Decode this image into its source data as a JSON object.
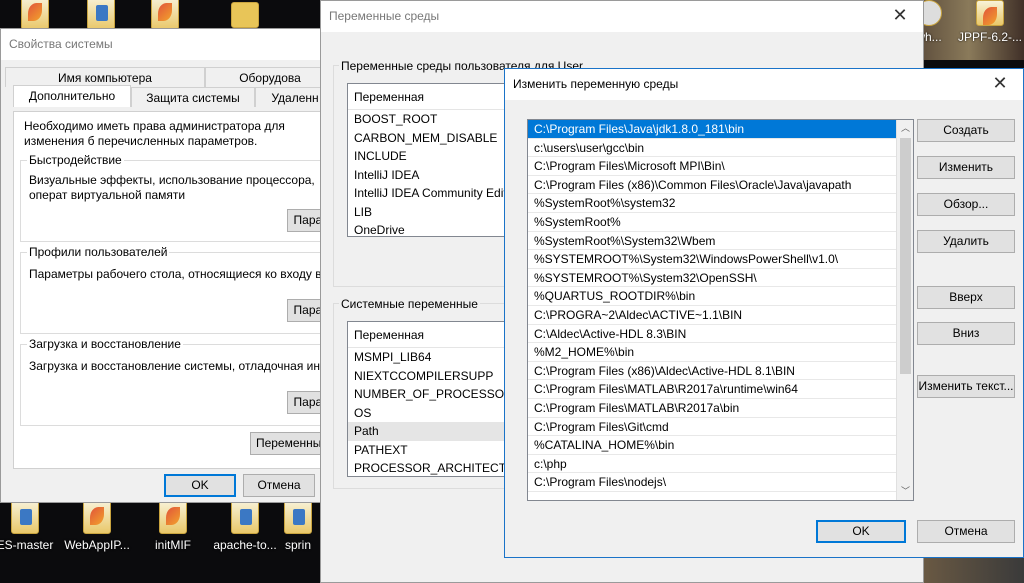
{
  "desktop": {
    "icons_top": [
      {
        "label": ""
      },
      {
        "label": ""
      },
      {
        "label": ""
      },
      {
        "label": ""
      },
      {
        "label": "wh..."
      },
      {
        "label": "JPPF-6.2-..."
      }
    ],
    "icons_bottom": [
      {
        "label": "ES-master"
      },
      {
        "label": "WebAppIP..."
      },
      {
        "label": "initMIF"
      },
      {
        "label": "apache-to..."
      },
      {
        "label": "sprin"
      }
    ]
  },
  "system_properties": {
    "title": "Свойства системы",
    "tabs_row1": [
      "Имя компьютера",
      "Оборудова"
    ],
    "tabs_row2": [
      "Дополнительно",
      "Защита системы",
      "Удаленн"
    ],
    "intro": "Необходимо иметь права администратора для изменения б перечисленных параметров.",
    "performance": {
      "title": "Быстродействие",
      "text": "Визуальные эффекты, использование процессора, операт виртуальной памяти",
      "button": "Парам"
    },
    "profiles": {
      "title": "Профили пользователей",
      "text": "Параметры рабочего стола, относящиеся ко входу в систе",
      "button": "Парам"
    },
    "startup": {
      "title": "Загрузка и восстановление",
      "text": "Загрузка и восстановление системы, отладочная информ",
      "button": "Парам"
    },
    "env_button": "Переменные",
    "ok": "OK",
    "cancel": "Отмена"
  },
  "env_vars": {
    "title": "Переменные среды",
    "close": "✕",
    "user_group": "Переменные среды пользователя для User",
    "user_header": "Переменная",
    "user_rows": [
      "BOOST_ROOT",
      "CARBON_MEM_DISABLE",
      "INCLUDE",
      "IntelliJ IDEA",
      "IntelliJ IDEA Community Edit...",
      "LIB",
      "OneDrive"
    ],
    "system_group": "Системные переменные",
    "system_header": "Переменная",
    "system_rows": [
      "MSMPI_LIB64",
      "NIEXTCCOMPILERSUPP",
      "NUMBER_OF_PROCESSORS",
      "OS",
      "Path",
      "PATHEXT",
      "PROCESSOR_ARCHITECTURE"
    ]
  },
  "edit_dialog": {
    "title": "Изменить переменную среды",
    "close": "✕",
    "paths": [
      "C:\\Program Files\\Java\\jdk1.8.0_181\\bin",
      "c:\\users\\user\\gcc\\bin",
      "C:\\Program Files\\Microsoft MPI\\Bin\\",
      "C:\\Program Files (x86)\\Common Files\\Oracle\\Java\\javapath",
      "%SystemRoot%\\system32",
      "%SystemRoot%",
      "%SystemRoot%\\System32\\Wbem",
      "%SYSTEMROOT%\\System32\\WindowsPowerShell\\v1.0\\",
      "%SYSTEMROOT%\\System32\\OpenSSH\\",
      "%QUARTUS_ROOTDIR%\\bin",
      "C:\\PROGRA~2\\Aldec\\ACTIVE~1.1\\BIN",
      "C:\\Aldec\\Active-HDL 8.3\\BIN",
      "%M2_HOME%\\bin",
      "C:\\Program Files (x86)\\Aldec\\Active-HDL 8.1\\BIN",
      "C:\\Program Files\\MATLAB\\R2017a\\runtime\\win64",
      "C:\\Program Files\\MATLAB\\R2017a\\bin",
      "C:\\Program Files\\Git\\cmd",
      "%CATALINA_HOME%\\bin",
      "c:\\php",
      "C:\\Program Files\\nodejs\\"
    ],
    "buttons": {
      "create": "Создать",
      "edit": "Изменить",
      "browse": "Обзор...",
      "delete": "Удалить",
      "up": "Вверх",
      "down": "Вниз",
      "edit_text": "Изменить текст...",
      "ok": "OK",
      "cancel": "Отмена"
    }
  }
}
